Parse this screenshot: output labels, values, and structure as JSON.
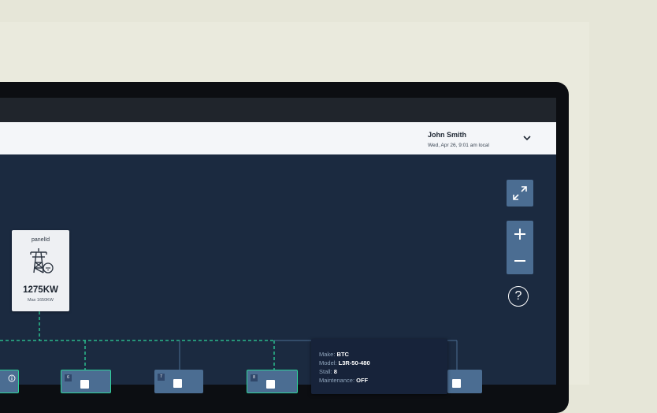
{
  "user": {
    "name": "John Smith",
    "timestamp": "Wed, Apr 26, 9:01 am local"
  },
  "panel": {
    "name": "panelId",
    "power": "1275KW",
    "max": "Max 1650KW"
  },
  "controls": {
    "help": "?"
  },
  "chargers": [
    {
      "num": "5"
    },
    {
      "num": "6"
    },
    {
      "num": "7"
    },
    {
      "num": "8"
    },
    {
      "num": ""
    }
  ],
  "tooltip": {
    "make_label": "Make:",
    "make": "BTC",
    "model_label": "Model:",
    "model": "L3R-50-480",
    "stall_label": "Stall:",
    "stall": "8",
    "maintenance_label": "Maintenance:",
    "maintenance": "OFF"
  },
  "colors": {
    "canvas": "#1b2a40",
    "accent": "#2ed39a",
    "control": "#4b6d92"
  }
}
